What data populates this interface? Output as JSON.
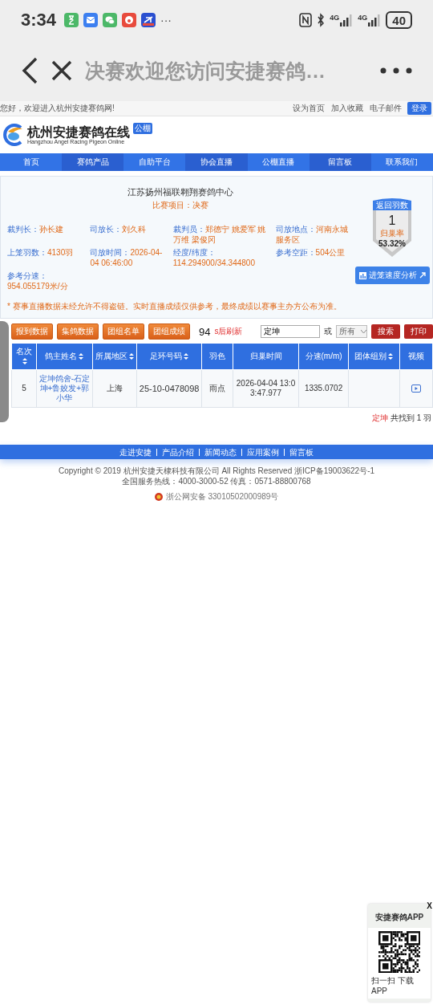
{
  "status_bar": {
    "time": "3:34",
    "more": "···",
    "networks": [
      "4G",
      "4G"
    ],
    "battery": "40"
  },
  "browser": {
    "title": "决赛欢迎您访问安捷赛鸽…"
  },
  "top_bar": {
    "greeting": "您好，欢迎进入杭州安捷赛鸽网!",
    "links": [
      "设为首页",
      "加入收藏",
      "电子邮件"
    ],
    "login": "登录"
  },
  "logo": {
    "name": "杭州安捷赛鸽在线",
    "english": "Hangzhou Angel Racing Pigeon Online",
    "badge": "公棚"
  },
  "nav": [
    "首页",
    "赛鸽产品",
    "自助平台",
    "协会直播",
    "公棚直播",
    "留言板",
    "联系我们"
  ],
  "race": {
    "organizer": "江苏扬州福联翱翔赛鸽中心",
    "project_label": "比赛项目：",
    "project": "决赛",
    "fields": [
      {
        "label": "裁判长：",
        "value": "孙长建"
      },
      {
        "label": "司放长：",
        "value": "刘久科"
      },
      {
        "label": "裁判员：",
        "value": "郑德宁 姚爱军 姚万维 梁俊冈"
      },
      {
        "label": "司放地点：",
        "value": "河南永城服务区"
      },
      {
        "label": "上笼羽数：",
        "value": "4130羽"
      },
      {
        "label": "司放时间：",
        "value": "2026-04-04 06:46:00"
      },
      {
        "label": "经度/纬度：",
        "value": "114.294900/34.344800"
      },
      {
        "label": "参考空距：",
        "value": "504公里"
      },
      {
        "label": "参考分速：",
        "value": "954.055179米/分"
      }
    ],
    "notice": "* 赛事直播数据未经允许不得盗链。实时直播成绩仅供参考，最终成绩以赛事主办方公布为准。",
    "returns": {
      "title": "返回羽数",
      "count": "1",
      "rate_label": "归巢率",
      "rate": "53.32%"
    },
    "analysis_button": "进笼速度分析"
  },
  "toolbar": {
    "buttons": [
      "报到数据",
      "集鸽数据",
      "团组名单",
      "团组成绩"
    ],
    "countdown": "94",
    "countdown_label": "s后刷新",
    "search_value": "定坤",
    "or_label": "或",
    "select": "所有",
    "search_button": "搜索",
    "print_button": "打印"
  },
  "table": {
    "columns": [
      {
        "label": "名次",
        "sortable": true
      },
      {
        "label": "鸽主姓名",
        "sortable": true
      },
      {
        "label": "所属地区",
        "sortable": true
      },
      {
        "label": "足环号码",
        "sortable": true
      },
      {
        "label": "羽色",
        "sortable": false
      },
      {
        "label": "归巢时间",
        "sortable": false
      },
      {
        "label": "分速(m/m)",
        "sortable": false
      },
      {
        "label": "团体组别",
        "sortable": true
      },
      {
        "label": "视频",
        "sortable": false
      }
    ],
    "rows": [
      {
        "rank": "5",
        "owner": "定坤鸽舍-石定坤+鲁姣发+郭小华",
        "region": "上海",
        "ring": "25-10-0478098",
        "plumage": "雨点",
        "time": "2026-04-04 13:03:47.977",
        "speed": "1335.0702",
        "video": true
      }
    ]
  },
  "result": {
    "keyword": "定坤",
    "text": "共找到 1 羽"
  },
  "footer": {
    "links": [
      "走进安捷",
      "产品介绍",
      "新闻动态",
      "应用案例",
      "留言板"
    ],
    "copyright": "Copyright © 2019 杭州安捷天棣科技有限公司 All Rights Reserved 浙ICP备19003622号-1",
    "hotline": "全国服务热线：4000-3000-52 传真：0571-88800768",
    "police": "浙公网安备 33010502000989号"
  },
  "app_popup": {
    "title": "安捷赛鸽APP",
    "caption": "扫一扫 下载APP",
    "close": "X"
  }
}
